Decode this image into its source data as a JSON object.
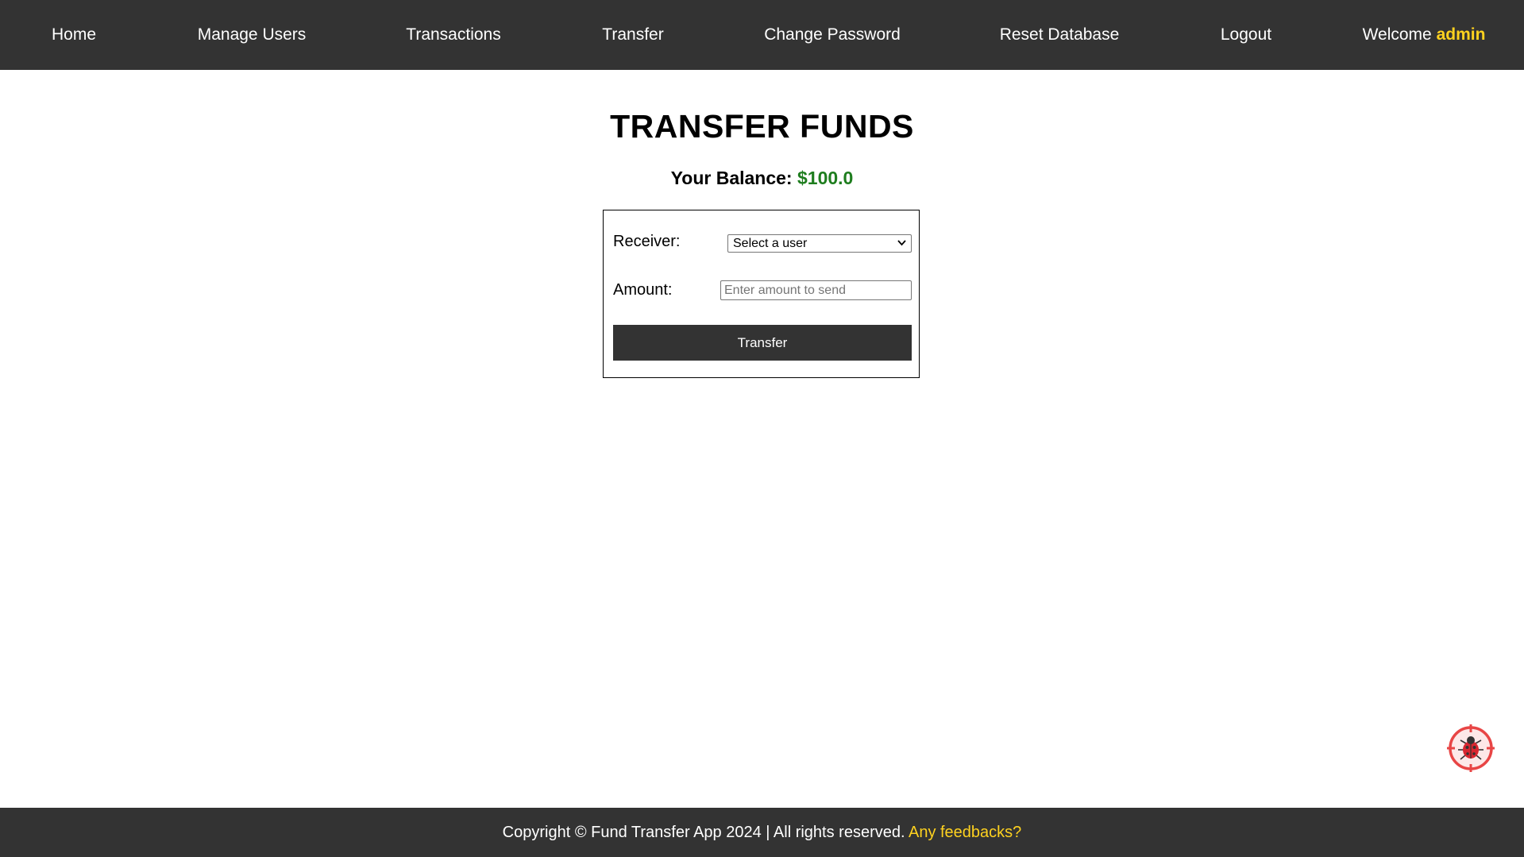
{
  "nav": {
    "items": [
      {
        "label": "Home"
      },
      {
        "label": "Manage Users"
      },
      {
        "label": "Transactions"
      },
      {
        "label": "Transfer"
      },
      {
        "label": "Change Password"
      },
      {
        "label": "Reset Database"
      },
      {
        "label": "Logout"
      }
    ],
    "welcome_prefix": "Welcome",
    "username": "admin"
  },
  "main": {
    "title": "TRANSFER FUNDS",
    "balance_label": "Your Balance:",
    "balance_value": "$100.0"
  },
  "form": {
    "receiver_label": "Receiver:",
    "receiver_selected": "Select a user",
    "amount_label": "Amount:",
    "amount_value": "",
    "amount_placeholder": "Enter amount to send",
    "submit_label": "Transfer"
  },
  "footer": {
    "copyright": "Copyright © Fund Transfer App 2024 | All rights reserved.",
    "feedback_link": "Any feedbacks?"
  },
  "widget": {
    "icon": "ladybug-target-icon"
  },
  "colors": {
    "nav_background": "#333333",
    "accent_yellow": "#ffd21f",
    "balance_green": "#1e7d1e",
    "button_background": "#333333"
  }
}
